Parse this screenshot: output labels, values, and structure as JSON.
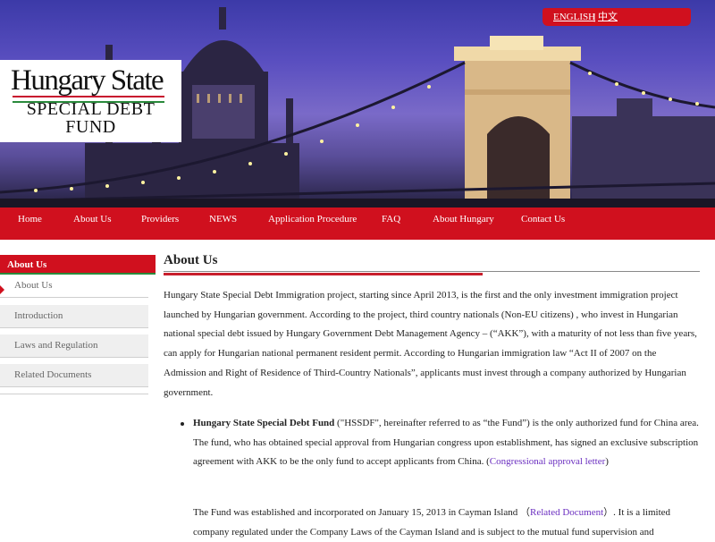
{
  "lang": {
    "english": "ENGLISH",
    "separator": "|",
    "chinese": "中文"
  },
  "logo": {
    "title": "Hungary State",
    "line1": "SPECIAL DEBT",
    "line2": "FUND"
  },
  "nav": [
    "Home",
    "About Us",
    "Providers",
    "NEWS",
    "Application Procedure",
    "FAQ",
    "About Hungary",
    "Contact Us"
  ],
  "sidebar": {
    "heading": "About Us",
    "items": [
      "About Us",
      "Introduction",
      "Laws and Regulation",
      "Related Documents"
    ]
  },
  "content": {
    "title": "About Us",
    "p1": "Hungary State Special Debt Immigration project, starting since April 2013, is the first and the only investment immigration project launched by Hungarian government. According to the project, third country nationals (Non-EU citizens) , who invest in Hungarian national special debt issued by Hungary Government Debt Management Agency – (“AKK”), with a maturity of not less than five years, can apply for Hungarian national permanent resident permit. According to Hungarian immigration law “Act II of 2007 on the Admission and Right of Residence of Third-Country Nationals”, applicants must invest through a company authorized by Hungarian government.",
    "bullet_bold": "Hungary State Special Debt Fund",
    "bullet_text": " (\"HSSDF\", hereinafter referred to as “the Fund”) is the only authorized fund for China area. The fund, who has obtained special approval from Hungarian congress upon establishment, has signed an exclusive subscription agreement with AKK to be the only fund to accept applicants from China. (",
    "bullet_link": "Congressional approval letter",
    "bullet_end": ")",
    "p2_start": "The Fund was established and incorporated on January 15, 2013 in Cayman Island （",
    "p2_link": "Related Document",
    "p2_end": "）. It is a limited company regulated under the Company Laws of the Cayman Island and is subject to the mutual fund supervision and"
  },
  "colors": {
    "brand_red": "#d0101e",
    "accent_green": "#2a8a3c",
    "link": "#6b2fc0"
  }
}
